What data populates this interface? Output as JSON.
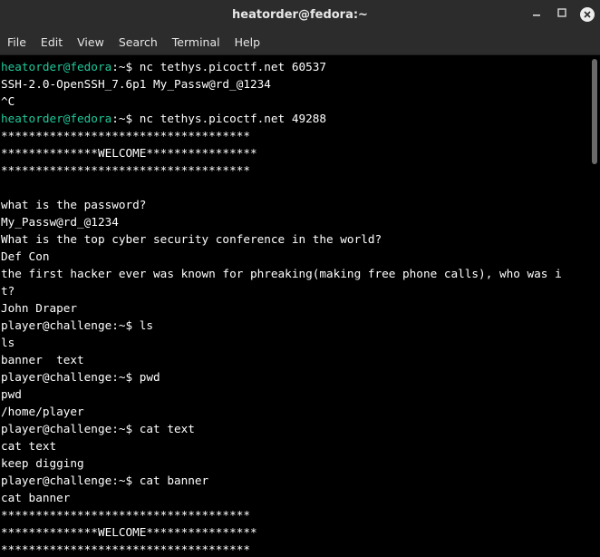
{
  "window": {
    "title": "heatorder@fedora:~"
  },
  "menu": [
    "File",
    "Edit",
    "View",
    "Search",
    "Terminal",
    "Help"
  ],
  "terminal": {
    "lines": [
      {
        "prompt_user": "heatorder@fedora",
        "prompt_rest": ":~$ ",
        "text": "nc tethys.picoctf.net 60537"
      },
      {
        "text": "SSH-2.0-OpenSSH_7.6p1 My_Passw@rd_@1234"
      },
      {
        "text": "^C"
      },
      {
        "prompt_user": "heatorder@fedora",
        "prompt_rest": ":~$ ",
        "text": "nc tethys.picoctf.net 49288"
      },
      {
        "text": "************************************"
      },
      {
        "text": "**************WELCOME****************"
      },
      {
        "text": "************************************"
      },
      {
        "text": ""
      },
      {
        "text": "what is the password?"
      },
      {
        "text": "My_Passw@rd_@1234"
      },
      {
        "text": "What is the top cyber security conference in the world?"
      },
      {
        "text": "Def Con"
      },
      {
        "text": "the first hacker ever was known for phreaking(making free phone calls), who was i"
      },
      {
        "text": "t?"
      },
      {
        "text": "John Draper"
      },
      {
        "text": "player@challenge:~$ ls"
      },
      {
        "text": "ls"
      },
      {
        "text": "banner  text"
      },
      {
        "text": "player@challenge:~$ pwd"
      },
      {
        "text": "pwd"
      },
      {
        "text": "/home/player"
      },
      {
        "text": "player@challenge:~$ cat text"
      },
      {
        "text": "cat text"
      },
      {
        "text": "keep digging"
      },
      {
        "text": "player@challenge:~$ cat banner"
      },
      {
        "text": "cat banner"
      },
      {
        "text": "************************************"
      },
      {
        "text": "**************WELCOME****************"
      },
      {
        "text": "************************************"
      }
    ]
  },
  "icons": {
    "minimize": "minimize-icon",
    "maximize": "maximize-icon",
    "close": "close-icon"
  },
  "colors": {
    "prompt_user": "#1fc99a",
    "prompt_path": "#4fa3ff",
    "text": "#ffffff",
    "background": "#000000",
    "chrome": "#2c2c2c"
  }
}
